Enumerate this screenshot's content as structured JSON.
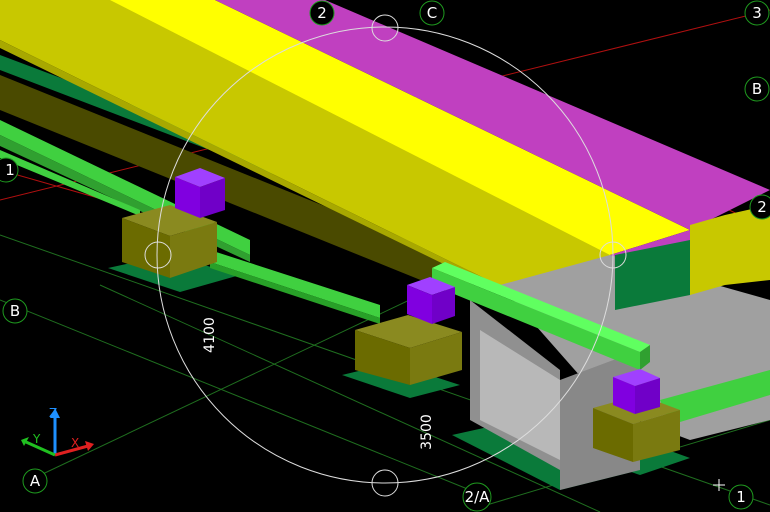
{
  "view": {
    "background": "#000000",
    "grid_line_color": "#1f7a1f",
    "red_line_color": "#b01010"
  },
  "grid_labels": {
    "g2_top": "2",
    "gC_top": "C",
    "g3_top": "3",
    "gB_right": "B",
    "g2_right": "2",
    "g1_left": "1",
    "gB_left": "B",
    "gA_left": "A",
    "g2A_bottom": "2/A",
    "g1_bottom": "1"
  },
  "dimensions": {
    "d1": "4100",
    "d2": "3500"
  },
  "axis_indicator": {
    "x": "X",
    "y": "Y",
    "z": "Z"
  },
  "colors": {
    "yellow": "#c8c800",
    "yellow_top": "#ffff00",
    "magenta": "#c040c0",
    "light_green": "#40d040",
    "dark_olive": "#4a4a00",
    "olive_block": "#6b6b00",
    "purple": "#8000e0",
    "dark_green": "#0a7a3a",
    "gray": "#a0a0a0"
  }
}
